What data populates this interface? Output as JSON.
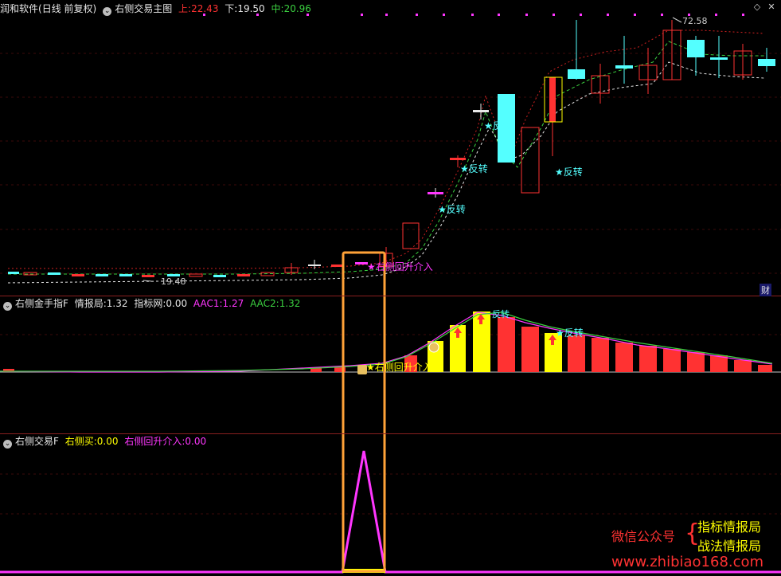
{
  "header": {
    "app_name": "润和软件",
    "period": "(日线 前复权)",
    "indicator": "右侧交易主图",
    "upper_label": "上:",
    "upper_value": "22.43",
    "lower_label": "下:",
    "lower_value": "19.50",
    "middle_label": "中:",
    "middle_value": "20.96"
  },
  "main_chart": {
    "high_label": "72.58",
    "low_label": "19.48",
    "reversal_label": "反转",
    "entry_label": "右侧回升介入",
    "finance_badge": "财"
  },
  "panel2": {
    "indicator": "右侧金手指F",
    "info_label": "情报局:",
    "info_value": "1.32",
    "net_label": "指标网:",
    "net_value": "0.00",
    "aac1_label": "AAC1:",
    "aac1_value": "1.27",
    "aac2_label": "AAC2:",
    "aac2_value": "1.32",
    "entry_label": "右侧回升介入",
    "reversal_label": "反转"
  },
  "panel3": {
    "indicator": "右侧交易F",
    "buy_label": "右侧买:",
    "buy_value": "0.00",
    "entry_label": "右侧回升介入:",
    "entry_value": "0.00"
  },
  "watermark": {
    "wechat": "微信公众号",
    "brace": "{",
    "line1": "指标情报局",
    "line2": "战法情报局",
    "url": "www.zhibiao168.com"
  },
  "colors": {
    "up": "#ff3232",
    "down": "#54ffff",
    "magenta": "#ff36ff",
    "yellow": "#ffff00",
    "highlight": "#ffa238"
  }
}
